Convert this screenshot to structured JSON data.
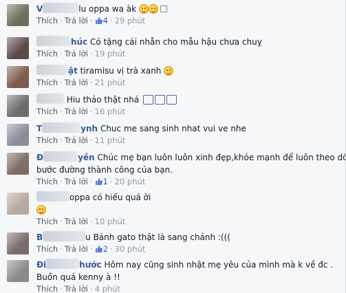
{
  "action_labels": {
    "like": "Thích",
    "reply": "Trả lời"
  },
  "comments": [
    {
      "name_prefix": "V",
      "text": "lu oppa wa àk",
      "likes": "4",
      "time": "29 phút",
      "avatar_color": "#6a6f5e"
    },
    {
      "name_prefix": "",
      "name_suffix": "húc",
      "text": "Có tặng cái nhẫn cho mẫu hậu chưa chuỵ",
      "likes": "",
      "time": "19 phút",
      "avatar_color": "#5b4a4a"
    },
    {
      "name_prefix": "",
      "name_suffix": "ật",
      "text": "tiramisu vị trà xanh",
      "likes": "",
      "time": "21 phút",
      "avatar_color": "#7b5b4b"
    },
    {
      "name_prefix": "",
      "name_suffix": "",
      "text": "Hiu thảo thật nhá",
      "likes": "",
      "time": "16 phút",
      "avatar_color": "#6c6c6c"
    },
    {
      "name_prefix": "T",
      "name_suffix": "ynh",
      "text": "Chuc me sang sinh nhat vui ve nhe",
      "likes": "",
      "time": "11 phút",
      "avatar_color": "#8a8e99"
    },
    {
      "name_prefix": "Đ",
      "name_suffix": "yền",
      "text": "Chúc mẹ bạn luôn luôn xinh đẹp,khỏe mạnh để luôn theo dõi",
      "text_line2": "bước đường thành công của bạn.",
      "likes": "1",
      "time": "20 phút",
      "avatar_color": "#7d6d63"
    },
    {
      "name_prefix": "",
      "name_suffix": "",
      "text": "oppa có hiếu quá ời",
      "likes": "",
      "time": "10 phút",
      "avatar_color": "#b7a9a0"
    },
    {
      "name_prefix": "B",
      "name_suffix": "",
      "text": "u Bánh gato thật là sang chảnh :(((",
      "likes": "2",
      "time": "30 phút",
      "avatar_color": "#7b6b6b"
    },
    {
      "name_prefix": "Đi",
      "name_suffix": "hước",
      "text": "Hôm nay cũng sinh nhật mẹ yêu của mình mà k về đc .",
      "text_line2": "Buồn quá kenny à !!",
      "likes": "",
      "time": "4 phút",
      "avatar_color": "#8a8a8a"
    }
  ],
  "colors": {
    "name": "#3b5998",
    "meta": "#9197a3",
    "link": "#4e5665",
    "background": "#f6f7f9"
  }
}
